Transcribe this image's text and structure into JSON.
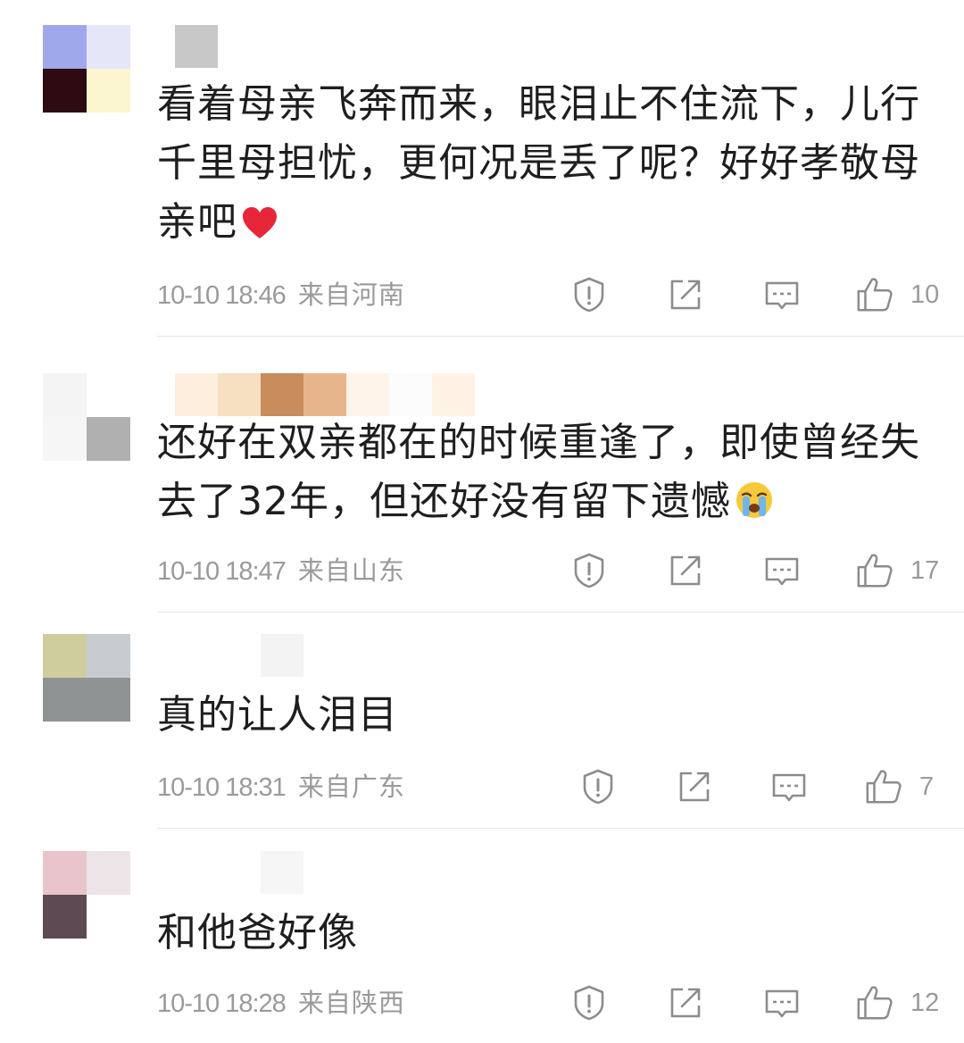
{
  "comments": [
    {
      "text": "看着母亲飞奔而来，眼泪止不住流下，儿行千里母担忧，更何况是丢了呢？好好孝敬母亲吧",
      "emoji": "heart-emoji",
      "time": "10-10 18:46",
      "location": "来自河南",
      "likes": "10",
      "avatar_colors": [
        "#9fa8ea",
        "#e5e6f8",
        "#2e0a12",
        "#fbf6cf"
      ],
      "name_colors": [
        "#ffffff",
        "#c8c8c8"
      ]
    },
    {
      "text": "还好在双亲都在的时候重逢了，即使曾经失去了32年，但还好没有留下遗憾",
      "emoji": "crying-emoji",
      "time": "10-10 18:47",
      "location": "来自山东",
      "likes": "17",
      "avatar_colors": [
        "#f4f4f4",
        "#ffffff",
        "#f6f6f6",
        "#b0b0b0"
      ],
      "name_colors": [
        "#fdeedd",
        "#f7dfc1",
        "#c98c5c",
        "#e7b58c",
        "#fff4ea",
        "#fff3e6",
        "#ffffff"
      ]
    },
    {
      "text": "真的让人泪目",
      "emoji": "",
      "time": "10-10 18:31",
      "location": "来自广东",
      "likes": "7",
      "avatar_colors": [
        "#cfcd9d",
        "#c6ccd0",
        "#909393",
        "#909393"
      ],
      "name_colors": [
        "#ffffff",
        "#f3f3f3"
      ]
    },
    {
      "text": "和他爸好像",
      "emoji": "",
      "time": "10-10 18:28",
      "location": "来自陕西",
      "likes": "12",
      "avatar_colors": [
        "#e9c4cc",
        "#ece4e6",
        "#5e4a52",
        "#ffffff"
      ],
      "name_colors": [
        "#ffffff",
        "#f6f6f6"
      ]
    }
  ],
  "icons": {
    "report": "report-icon",
    "share": "share-icon",
    "comment": "comment-icon",
    "like": "thumb-up-icon"
  }
}
